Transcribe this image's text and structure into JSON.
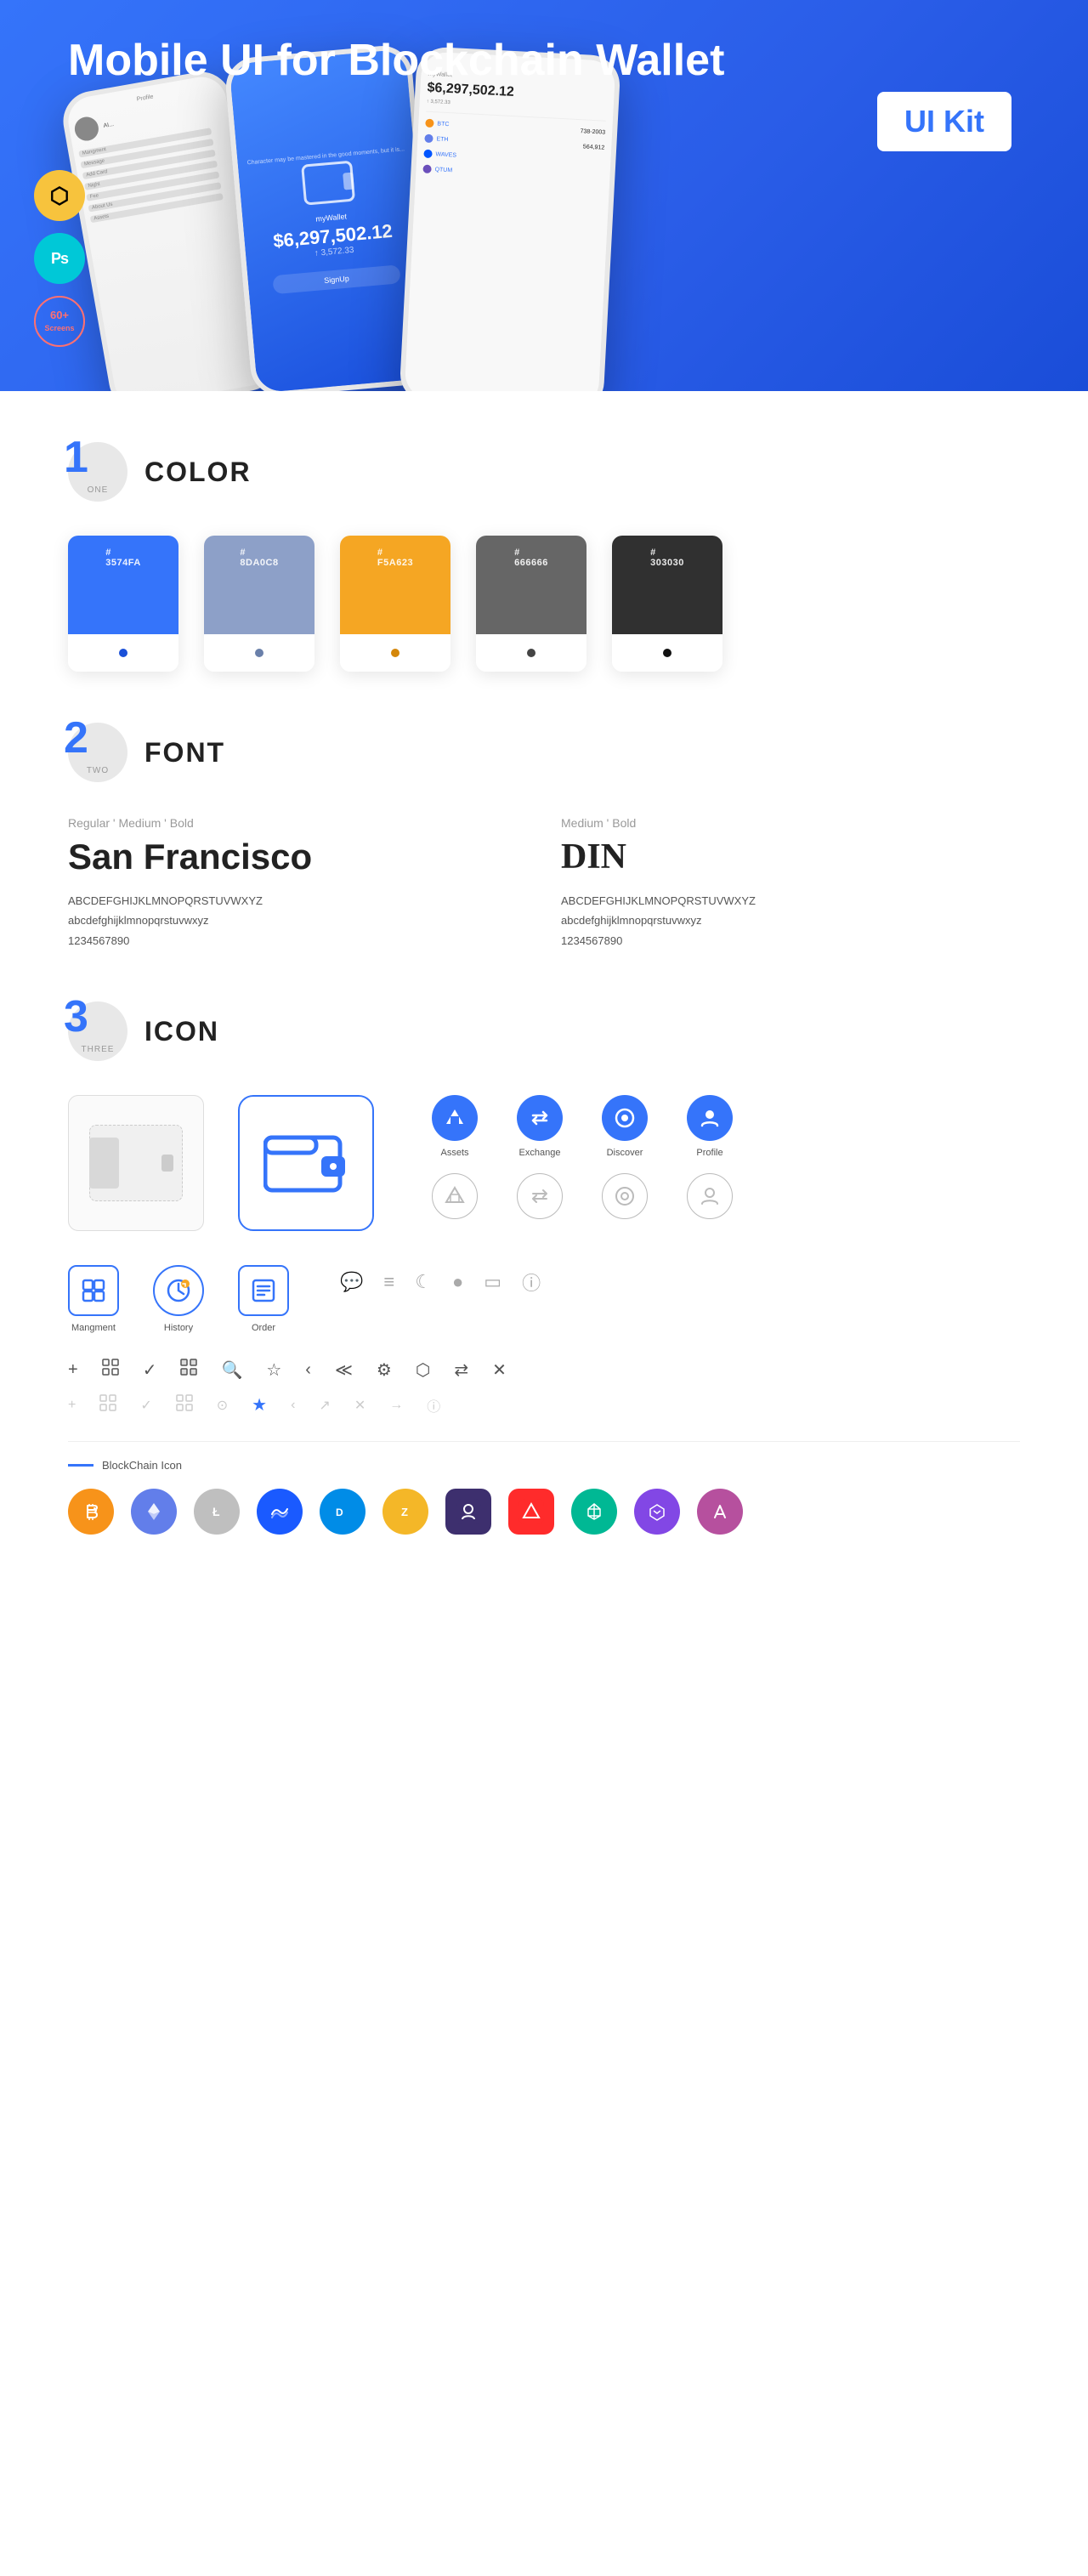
{
  "hero": {
    "title_normal": "Mobile UI for Blockchain ",
    "title_bold": "Wallet",
    "badge": "UI Kit",
    "sketch_label": "Sketch",
    "ps_label": "Ps",
    "screens_label": "60+\nScreens"
  },
  "sections": {
    "color": {
      "number": "1",
      "word": "ONE",
      "title": "COLOR",
      "swatches": [
        {
          "hex": "#3574FA",
          "display": "#\n3574FA",
          "dot_color": "#1a50d8"
        },
        {
          "hex": "#8DA0C8",
          "display": "#\n8DA0C8",
          "dot_color": "#6a80aa"
        },
        {
          "hex": "#F5A623",
          "display": "#\nF5A623",
          "dot_color": "#d4870a"
        },
        {
          "hex": "#666666",
          "display": "#\n666666",
          "dot_color": "#444"
        },
        {
          "hex": "#303030",
          "display": "#\n303030",
          "dot_color": "#111"
        }
      ]
    },
    "font": {
      "number": "2",
      "word": "TWO",
      "title": "FONT",
      "font1": {
        "styles": "Regular ' Medium ' Bold",
        "name": "San Francisco",
        "upper": "ABCDEFGHIJKLMNOPQRSTUVWXYZ",
        "lower": "abcdefghijklmnopqrstuvwxyz",
        "nums": "1234567890"
      },
      "font2": {
        "styles": "Medium ' Bold",
        "name": "DIN",
        "upper": "ABCDEFGHIJKLMNOPQRSTUVWXYZ",
        "lower": "abcdefghijklmnopqrstuvwxyz",
        "nums": "1234567890"
      }
    },
    "icon": {
      "number": "3",
      "word": "THREE",
      "title": "ICON",
      "nav_icons": [
        {
          "label": "Assets",
          "symbol": "◆"
        },
        {
          "label": "Exchange",
          "symbol": "↔"
        },
        {
          "label": "Discover",
          "symbol": "⊙"
        },
        {
          "label": "Profile",
          "symbol": "👤"
        }
      ],
      "action_icons": [
        {
          "label": "Mangment",
          "type": "blue-box",
          "symbol": "⊡"
        },
        {
          "label": "History",
          "type": "blue-circle",
          "symbol": "◷"
        },
        {
          "label": "Order",
          "type": "blue-box",
          "symbol": "≡"
        }
      ],
      "small_icons": [
        "+",
        "⊞",
        "✓",
        "⊟",
        "🔍",
        "☆",
        "‹",
        "≪",
        "⚙",
        "⊡",
        "⇄",
        "✕"
      ],
      "blockchain_label": "BlockChain Icon",
      "crypto_coins": [
        {
          "label": "BTC",
          "color": "#F7931A",
          "symbol": "₿"
        },
        {
          "label": "ETH",
          "color": "#627EEA",
          "symbol": "Ξ"
        },
        {
          "label": "LTC",
          "color": "#bfbfbf",
          "symbol": "Ł"
        },
        {
          "label": "WAVES",
          "color": "#0055FF",
          "symbol": "W"
        },
        {
          "label": "DASH",
          "color": "#008CE7",
          "symbol": "D"
        },
        {
          "label": "ZEC",
          "color": "#F4B728",
          "symbol": "Z"
        },
        {
          "label": "GRD",
          "color": "#6B4FBB",
          "symbol": "⊞"
        },
        {
          "label": "AUG",
          "color": "#FF2B2B",
          "symbol": "△"
        },
        {
          "label": "CRY",
          "color": "#00D4AA",
          "symbol": "◇"
        },
        {
          "label": "POL",
          "color": "#8247E5",
          "symbol": "⬡"
        },
        {
          "label": "AAVE",
          "color": "#B6509E",
          "symbol": "∞"
        }
      ]
    }
  }
}
